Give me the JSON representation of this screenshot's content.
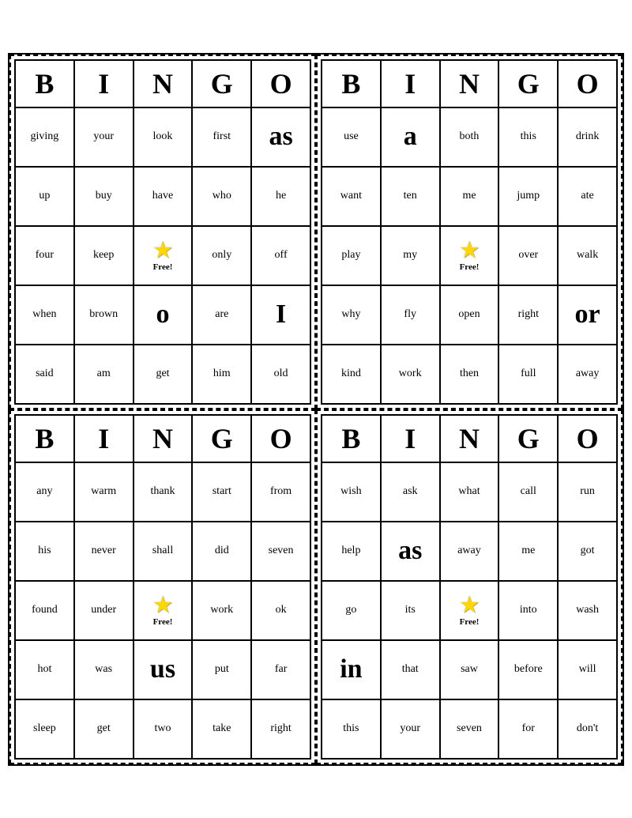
{
  "cards": [
    {
      "id": "card1",
      "headers": [
        "B",
        "I",
        "N",
        "G",
        "O"
      ],
      "rows": [
        [
          "giving",
          "your",
          "look",
          "first",
          "as"
        ],
        [
          "up",
          "buy",
          "have",
          "who",
          "he"
        ],
        [
          "four",
          "keep",
          "FREE",
          "only",
          "off"
        ],
        [
          "when",
          "brown",
          "o",
          "are",
          "I"
        ],
        [
          "said",
          "am",
          "get",
          "him",
          "old"
        ]
      ],
      "large_cells": [
        [
          0,
          4
        ],
        [
          3,
          2
        ],
        [
          3,
          4
        ]
      ],
      "free_pos": [
        2,
        2
      ]
    },
    {
      "id": "card2",
      "headers": [
        "B",
        "I",
        "N",
        "G",
        "O"
      ],
      "rows": [
        [
          "use",
          "a",
          "both",
          "this",
          "drink"
        ],
        [
          "want",
          "ten",
          "me",
          "jump",
          "ate"
        ],
        [
          "play",
          "my",
          "FREE",
          "over",
          "walk"
        ],
        [
          "why",
          "fly",
          "open",
          "right",
          "or"
        ],
        [
          "kind",
          "work",
          "then",
          "full",
          "away"
        ]
      ],
      "large_cells": [
        [
          0,
          1
        ],
        [
          3,
          4
        ]
      ],
      "free_pos": [
        2,
        2
      ]
    },
    {
      "id": "card3",
      "headers": [
        "B",
        "I",
        "N",
        "G",
        "O"
      ],
      "rows": [
        [
          "any",
          "warm",
          "thank",
          "start",
          "from"
        ],
        [
          "his",
          "never",
          "shall",
          "did",
          "seven"
        ],
        [
          "found",
          "under",
          "FREE",
          "work",
          "ok"
        ],
        [
          "hot",
          "was",
          "us",
          "put",
          "far"
        ],
        [
          "sleep",
          "get",
          "two",
          "take",
          "right"
        ]
      ],
      "large_cells": [
        [
          3,
          2
        ]
      ],
      "free_pos": [
        2,
        2
      ]
    },
    {
      "id": "card4",
      "headers": [
        "B",
        "I",
        "N",
        "G",
        "O"
      ],
      "rows": [
        [
          "wish",
          "ask",
          "what",
          "call",
          "run"
        ],
        [
          "help",
          "as",
          "away",
          "me",
          "got"
        ],
        [
          "go",
          "its",
          "FREE",
          "into",
          "wash"
        ],
        [
          "in",
          "that",
          "saw",
          "before",
          "will"
        ],
        [
          "this",
          "your",
          "seven",
          "for",
          "don't"
        ]
      ],
      "large_cells": [
        [
          1,
          1
        ],
        [
          3,
          0
        ]
      ],
      "free_pos": [
        2,
        2
      ]
    }
  ],
  "large_words": {
    "card1": {
      "0,4": "as",
      "3,2": "o",
      "3,4": "I"
    },
    "card2": {
      "0,1": "a",
      "3,4": "or"
    },
    "card3": {
      "3,2": "us"
    },
    "card4": {
      "1,1": "as",
      "3,0": "in"
    }
  }
}
